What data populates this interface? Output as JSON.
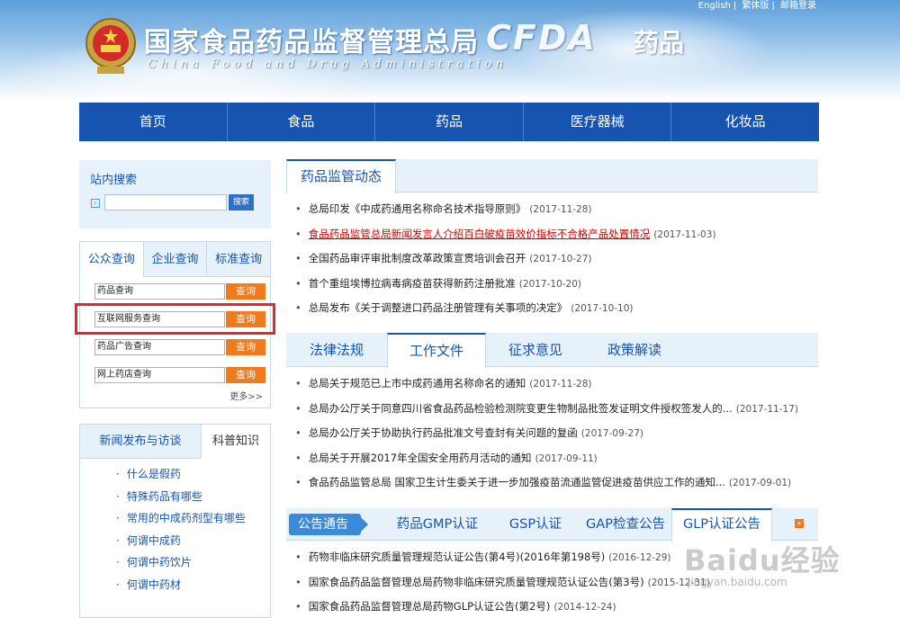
{
  "header": {
    "top_links": [
      "English",
      "繁体版",
      "邮箱登录"
    ],
    "title_cn": "国家食品药品监督管理总局",
    "title_en": "China Food and Drug Administration",
    "abbr": "CFDA",
    "section": "药品"
  },
  "nav": {
    "items": [
      "首页",
      "食品",
      "药品",
      "医疗器械",
      "化妆品"
    ]
  },
  "search": {
    "title": "站内搜索",
    "placeholder": "",
    "button": "搜索"
  },
  "query": {
    "tabs": [
      "公众查询",
      "企业查询",
      "标准查询"
    ],
    "rows": [
      {
        "label": "药品查询",
        "button": "查询"
      },
      {
        "label": "互联网服务查询",
        "button": "查询"
      },
      {
        "label": "药品广告查询",
        "button": "查询"
      },
      {
        "label": "网上药店查询",
        "button": "查询"
      }
    ],
    "more": "更多>>"
  },
  "news_left": {
    "tabs": [
      "新闻发布与访谈",
      "科普知识"
    ],
    "items": [
      "什么是假药",
      "特殊药品有哪些",
      "常用的中成药剂型有哪些",
      "何谓中成药",
      "何谓中药饮片",
      "何谓中药材"
    ]
  },
  "panel1": {
    "tab": "药品监管动态",
    "items": [
      {
        "text": "总局印发《中成药通用名称命名技术指导原则》",
        "date": "(2017-11-28)"
      },
      {
        "text": "食品药品监管总局新闻发言人介绍百白破疫苗效价指标不合格产品处置情况",
        "date": "(2017-11-03)"
      },
      {
        "text": "全国药品审评审批制度改革政策宣贯培训会召开",
        "date": "(2017-10-27)"
      },
      {
        "text": "首个重组埃博拉病毒病疫苗获得新药注册批准",
        "date": "(2017-10-20)"
      },
      {
        "text": "总局发布《关于调整进口药品注册管理有关事项的决定》",
        "date": "(2017-10-10)"
      }
    ]
  },
  "panel2": {
    "tabs": [
      "法律法规",
      "工作文件",
      "征求意见",
      "政策解读"
    ],
    "items": [
      {
        "text": "总局关于规范已上市中成药通用名称命名的通知",
        "date": "(2017-11-28)"
      },
      {
        "text": "总局办公厅关于同意四川省食品药品检验检测院变更生物制品批签发证明文件授权签发人的...",
        "date": "(2017-11-17)"
      },
      {
        "text": "总局办公厅关于协助执行药品批准文号查封有关问题的复函",
        "date": "(2017-09-27)"
      },
      {
        "text": "总局关于开展2017年全国安全用药月活动的通知",
        "date": "(2017-09-11)"
      },
      {
        "text": "食品药品监管总局 国家卫生计生委关于进一步加强疫苗流通监管促进疫苗供应工作的通知...",
        "date": "(2017-09-01)"
      }
    ]
  },
  "panel3": {
    "badge": "公告通告",
    "tabs": [
      "药品GMP认证",
      "GSP认证",
      "GAP检查公告",
      "GLP认证公告"
    ],
    "items": [
      {
        "text": "药物非临床研究质量管理规范认证公告(第4号)(2016年第198号)",
        "date": "(2016-12-29)"
      },
      {
        "text": "国家食品药品监督管理总局药物非临床研究质量管理规范认证公告(第3号)",
        "date": "(2015-12-31)"
      },
      {
        "text": "国家食品药品监督管理总局药物GLP认证公告(第2号)",
        "date": "(2014-12-24)"
      }
    ]
  },
  "watermark": {
    "main": "Baidu经验",
    "sub": "jingyan.baidu.com"
  },
  "colors": {
    "nav_blue": "#1654b0",
    "orange_button": "#f07a1e",
    "highlight_red": "#d80000",
    "annotation_red": "#e8262a"
  }
}
